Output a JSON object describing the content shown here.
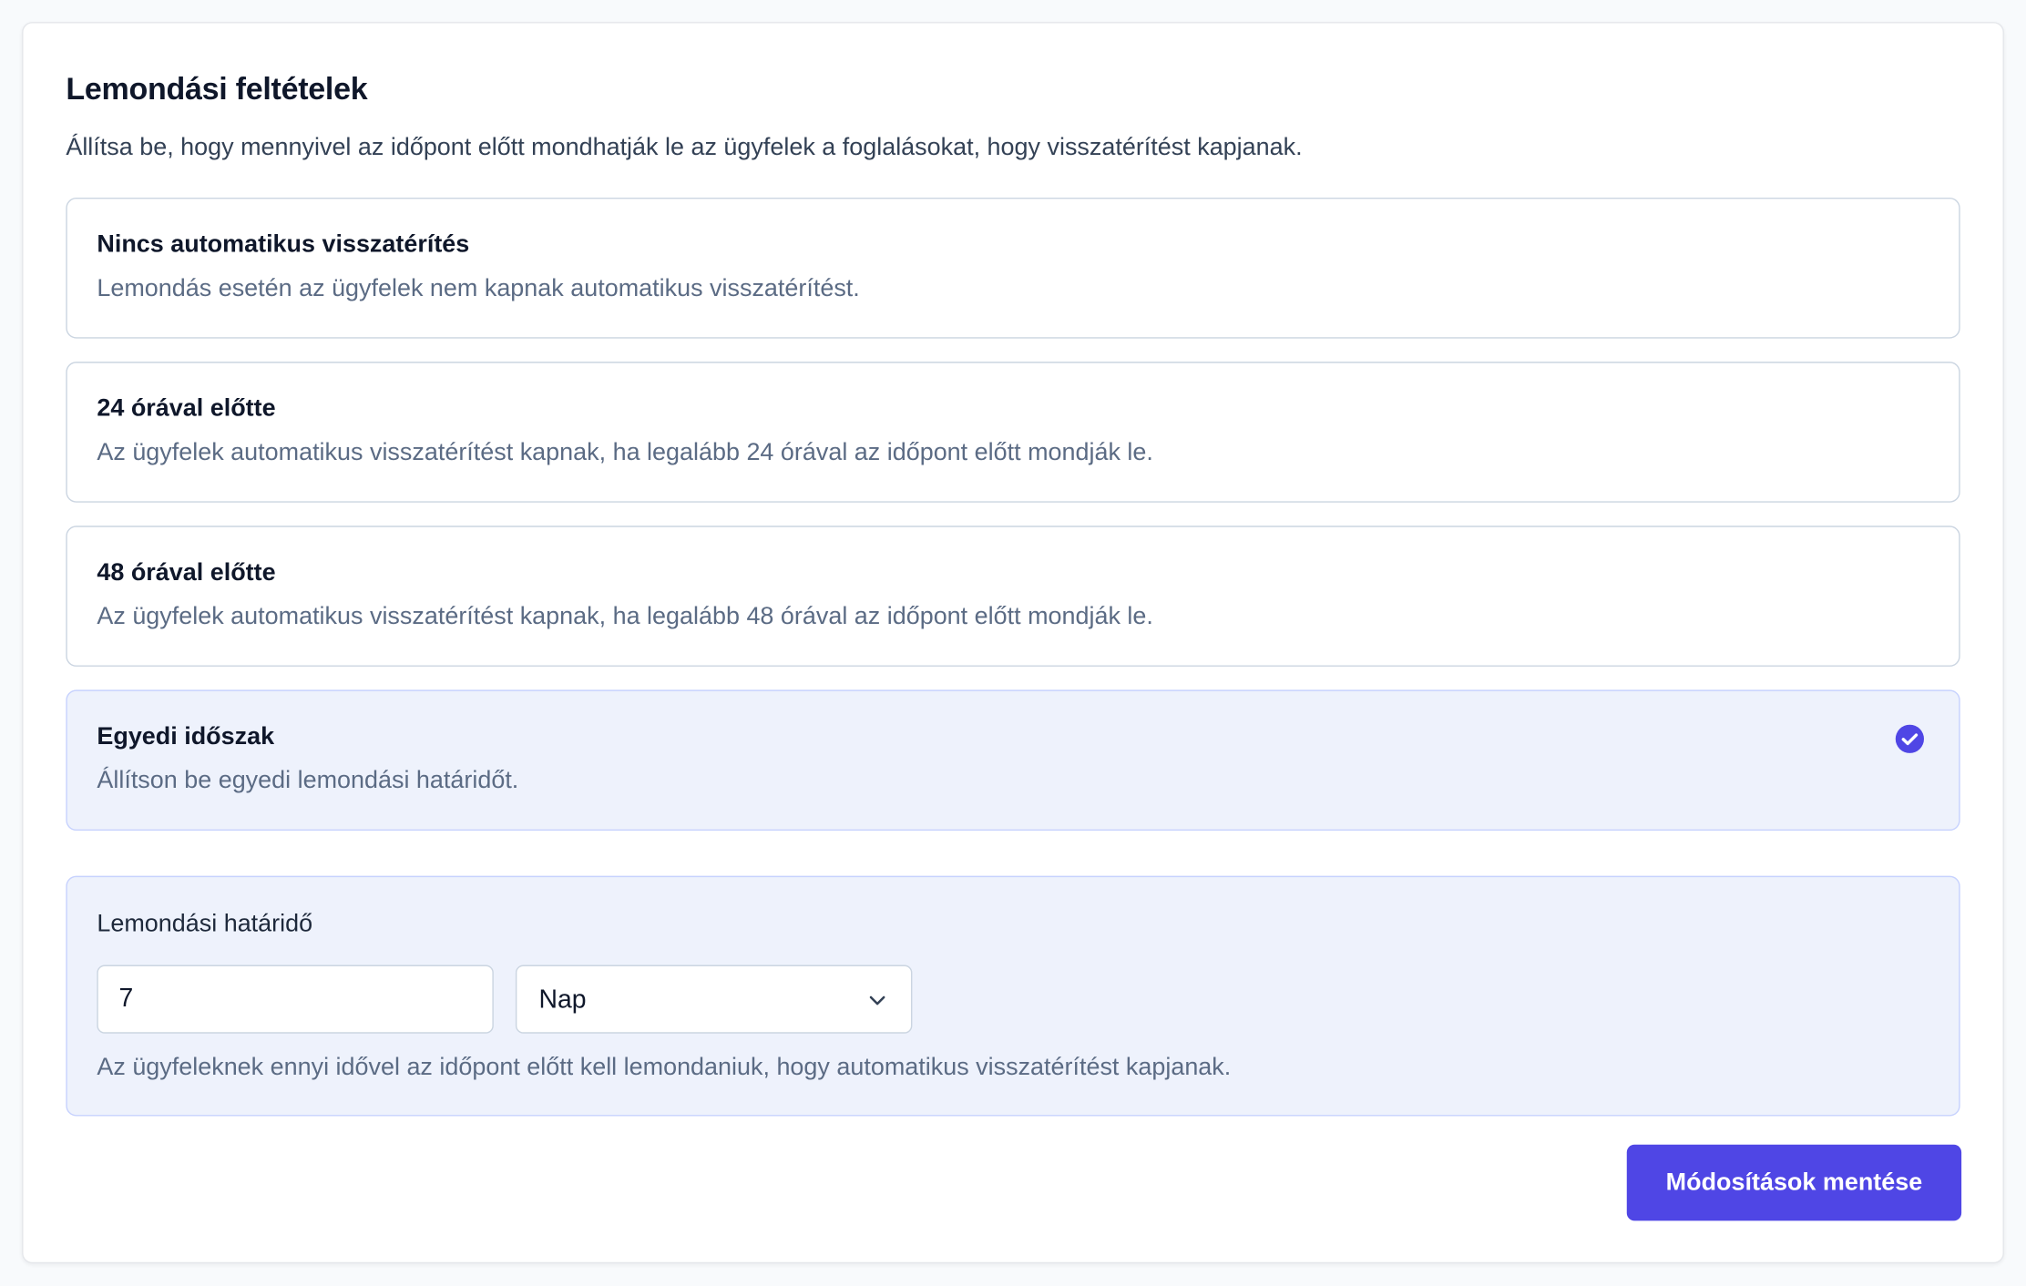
{
  "page": {
    "title": "Lemondási feltételek",
    "subtitle": "Állítsa be, hogy mennyivel az időpont előtt mondhatják le az ügyfelek a foglalásokat, hogy visszatérítést kapjanak."
  },
  "options": [
    {
      "title": "Nincs automatikus visszatérítés",
      "description": "Lemondás esetén az ügyfelek nem kapnak automatikus visszatérítést.",
      "selected": false
    },
    {
      "title": "24 órával előtte",
      "description": "Az ügyfelek automatikus visszatérítést kapnak, ha legalább 24 órával az időpont előtt mondják le.",
      "selected": false
    },
    {
      "title": "48 órával előtte",
      "description": "Az ügyfelek automatikus visszatérítést kapnak, ha legalább 48 órával az időpont előtt mondják le.",
      "selected": false
    },
    {
      "title": "Egyedi időszak",
      "description": "Állítson be egyedi lemondási határidőt.",
      "selected": true
    }
  ],
  "deadline": {
    "label": "Lemondási határidő",
    "amount": "7",
    "unit": "Nap",
    "help": "Az ügyfeleknek ennyi idővel az időpont előtt kell lemondaniuk, hogy automatikus visszatérítést kapjanak."
  },
  "actions": {
    "save_label": "Módosítások mentése"
  },
  "colors": {
    "accent": "#4f46e5",
    "selected_bg": "#eef2fc",
    "border": "#cbd5e1"
  },
  "icons": {
    "selected": "check-circle-icon",
    "dropdown": "chevron-down-icon"
  }
}
